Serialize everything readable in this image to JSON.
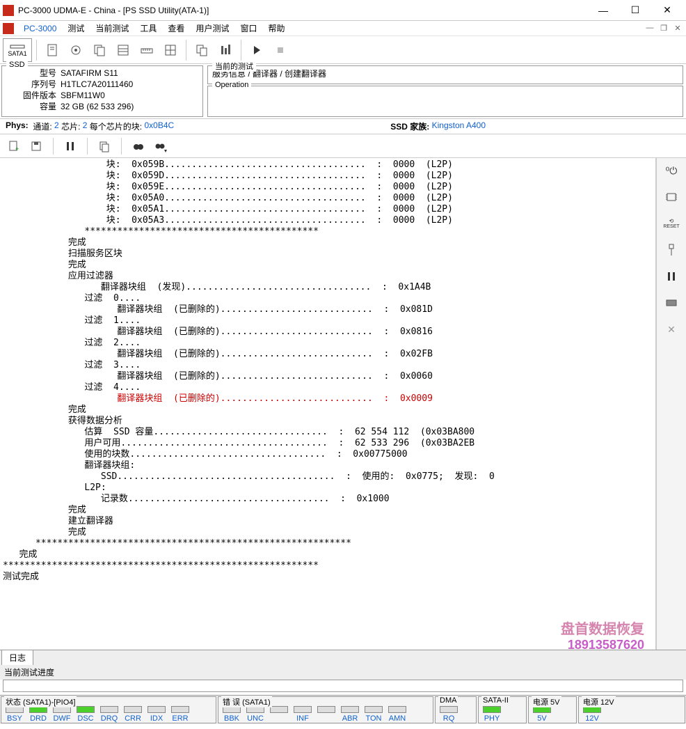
{
  "titlebar": {
    "title": "PC-3000 UDMA-E - China - [PS SSD Utility(ATA-1)]"
  },
  "menubar": {
    "app": "PC-3000",
    "items": [
      "测试",
      "当前测试",
      "工具",
      "查看",
      "用户测试",
      "窗口",
      "帮助"
    ]
  },
  "toolbar": {
    "sata": "SATA1"
  },
  "ssd_panel": {
    "legend": "SSD",
    "model_lbl": "型号",
    "model": "SATAFIRM   S11",
    "serial_lbl": "序列号",
    "serial": "H1TLC7A20111460",
    "fw_lbl": "固件版本",
    "fw": "SBFM11W0",
    "cap_lbl": "容量",
    "cap": "32 GB (62 533 296)"
  },
  "cur_test": {
    "legend": "当前的测试",
    "line": "服务信息 / 翻译器 / 创建翻译器"
  },
  "operation": {
    "legend": "Operation"
  },
  "phys": {
    "label": "Phys:",
    "ch_lbl": "通道:",
    "ch": "2",
    "chip_lbl": "芯片:",
    "chip": "2",
    "blk_lbl": "每个芯片的块:",
    "blk": "0x0B4C",
    "ssd_family_lbl": "SSD 家族:",
    "ssd_family": "Kingston A400"
  },
  "log_lines": [
    "                   块:  0x059B.....................................  :  0000  (L2P)",
    "                   块:  0x059D.....................................  :  0000  (L2P)",
    "                   块:  0x059E.....................................  :  0000  (L2P)",
    "                   块:  0x05A0.....................................  :  0000  (L2P)",
    "                   块:  0x05A1.....................................  :  0000  (L2P)",
    "                   块:  0x05A3.....................................  :  0000  (L2P)",
    "               *******************************************",
    "            完成",
    "",
    "            扫描服务区块",
    "            完成",
    "",
    "            应用过滤器",
    "                  翻译器块组  (发现)..................................  :  0x1A4B",
    "",
    "               过滤  0....",
    "                     翻译器块组  (已删除的)............................  :  0x081D",
    "",
    "               过滤  1....",
    "                     翻译器块组  (已删除的)............................  :  0x0816",
    "",
    "               过滤  2....",
    "                     翻译器块组  (已删除的)............................  :  0x02FB",
    "",
    "               过滤  3....",
    "                     翻译器块组  (已删除的)............................  :  0x0060",
    "",
    "               过滤  4....",
    "RED:                     翻译器块组  (已删除的)............................  :  0x0009",
    "            完成",
    "",
    "            获得数据分析",
    "               估算  SSD 容量................................  :  62 554 112  (0x03BA800",
    "               用户可用......................................  :  62 533 296  (0x03BA2EB",
    "               使用的块数....................................  :  0x00775000",
    "",
    "               翻译器块组:",
    "                  SSD........................................  :  使用的:  0x0775;  发现:  0",
    "",
    "               L2P:",
    "                  记录数.....................................  :  0x1000",
    "            完成",
    "",
    "            建立翻译器",
    "            完成",
    "      **********************************************************",
    "   完成",
    "**********************************************************",
    "测试完成"
  ],
  "tab": {
    "log": "日志"
  },
  "progress_label": "当前测试进度",
  "status": {
    "state_grp": "状态 (SATA1)-[PIO4]",
    "state_cells": [
      "BSY",
      "DRD",
      "DWF",
      "DSC",
      "DRQ",
      "CRR",
      "IDX",
      "ERR"
    ],
    "state_on": [
      false,
      true,
      false,
      true,
      false,
      false,
      false,
      false
    ],
    "err_grp": "错 误 (SATA1)",
    "err_cells": [
      "BBK",
      "UNC",
      "",
      "INF",
      "",
      "ABR",
      "TON",
      "AMN"
    ],
    "dma_grp": "DMA",
    "dma_cell": "RQ",
    "sata2_grp": "SATA-II",
    "sata2_cell": "PHY",
    "pwr5_grp": "电源 5V",
    "pwr5_cell": "5V",
    "pwr12_grp": "电源 12V",
    "pwr12_cell": "12V"
  },
  "side_tools": [
    "power-icon",
    "chip-icon",
    "reset-icon",
    "usb-icon",
    "pause-icon",
    "chip2-icon",
    "tools-icon"
  ],
  "watermark": {
    "text": "盘首数据恢复",
    "phone": "18913587620"
  }
}
